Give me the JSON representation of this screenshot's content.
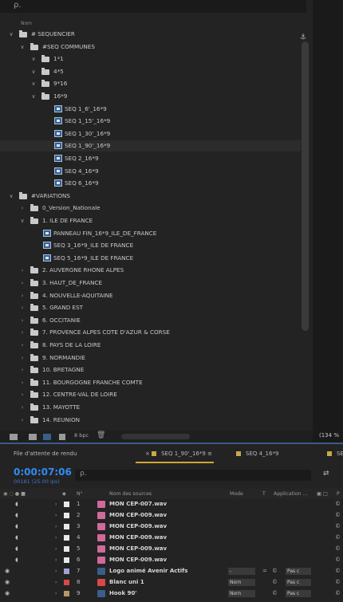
{
  "project": {
    "search_glyph": "ρ.",
    "column_header": "Nom",
    "tree": [
      {
        "label": "# SEQUENCIER",
        "type": "folder",
        "depth": 0,
        "expanded": true
      },
      {
        "label": "#SEQ COMMUNES",
        "type": "folder",
        "depth": 1,
        "expanded": true
      },
      {
        "label": "1*1",
        "type": "folder",
        "depth": 2,
        "expanded": true
      },
      {
        "label": "4*5",
        "type": "folder",
        "depth": 2,
        "expanded": true
      },
      {
        "label": "9*16",
        "type": "folder",
        "depth": 2,
        "expanded": true
      },
      {
        "label": "16*9",
        "type": "folder",
        "depth": 2,
        "expanded": true
      },
      {
        "label": "SEQ 1_6'_16*9",
        "type": "comp",
        "depth": 3
      },
      {
        "label": "SEQ 1_15'_16*9",
        "type": "comp",
        "depth": 3
      },
      {
        "label": "SEQ 1_30'_16*9",
        "type": "comp",
        "depth": 3
      },
      {
        "label": "SEQ 1_90'_16*9",
        "type": "comp",
        "depth": 3
      },
      {
        "label": "SEQ 2_16*9",
        "type": "comp",
        "depth": 3
      },
      {
        "label": "SEQ 4_16*9",
        "type": "comp",
        "depth": 3
      },
      {
        "label": "SEQ 6_16*9",
        "type": "comp",
        "depth": 3
      },
      {
        "label": "#VARIATIONS",
        "type": "folder",
        "depth": 0,
        "expanded": true
      },
      {
        "label": "0_Version_Nationale",
        "type": "folder",
        "depth": 1,
        "expanded": false
      },
      {
        "label": "1. ILE DE FRANCE",
        "type": "folder",
        "depth": 1,
        "expanded": true
      },
      {
        "label": "PANNEAU FIN_16*9_ILE_DE_FRANCE",
        "type": "comp",
        "depth": 2
      },
      {
        "label": "SEQ 3_16*9_ILE DE FRANCE",
        "type": "comp",
        "depth": 2
      },
      {
        "label": "SEQ 5_16*9_ILE DE FRANCE",
        "type": "comp",
        "depth": 2
      },
      {
        "label": "2. AUVERGNE RHONE ALPES",
        "type": "folder",
        "depth": 1,
        "expanded": false
      },
      {
        "label": "3. HAUT_DE_FRANCE",
        "type": "folder",
        "depth": 1,
        "expanded": false
      },
      {
        "label": "4. NOUVELLE-AQUITAINE",
        "type": "folder",
        "depth": 1,
        "expanded": false
      },
      {
        "label": "5. GRAND EST",
        "type": "folder",
        "depth": 1,
        "expanded": false
      },
      {
        "label": "6. OCCITANIE",
        "type": "folder",
        "depth": 1,
        "expanded": false
      },
      {
        "label": "7. PROVENCE ALPES COTE D'AZUR & CORSE",
        "type": "folder",
        "depth": 1,
        "expanded": false
      },
      {
        "label": "8. PAYS DE LA LOIRE",
        "type": "folder",
        "depth": 1,
        "expanded": false
      },
      {
        "label": "9. NORMANDIE",
        "type": "folder",
        "depth": 1,
        "expanded": false
      },
      {
        "label": "10. BRETAGNE",
        "type": "folder",
        "depth": 1,
        "expanded": false
      },
      {
        "label": "11. BOURGOGNE FRANCHE COMTE",
        "type": "folder",
        "depth": 1,
        "expanded": false
      },
      {
        "label": "12. CENTRE-VAL DE LOIRE",
        "type": "folder",
        "depth": 1,
        "expanded": false
      },
      {
        "label": "13. MAYOTTE",
        "type": "folder",
        "depth": 1,
        "expanded": false
      },
      {
        "label": "14. REUNION",
        "type": "folder",
        "depth": 1,
        "expanded": false
      }
    ],
    "bpc_label": "8 bpc"
  },
  "viewer": {
    "zoom_label": "(134 %"
  },
  "timeline": {
    "tabs": [
      {
        "label": "File d'attente de rendu",
        "active": false,
        "color": null
      },
      {
        "label": "SEQ 1_90'_16*9",
        "active": true,
        "color": "#c8a84a"
      },
      {
        "label": "SEQ 4_16*9",
        "active": false,
        "color": "#c8a84a"
      },
      {
        "label": "SE",
        "active": false,
        "color": "#c8a84a"
      }
    ],
    "timecode": "0:00:07:06",
    "frames": "00181 (25.00 ips)",
    "search_glyph": "ρ.",
    "headers": {
      "num": "N°",
      "source": "Nom des sources",
      "mode": "Mode",
      "t": "T",
      "application": "Application ...",
      "p": "P"
    },
    "layers": [
      {
        "num": "1",
        "name": "MON CEP-007.wav",
        "kind": "audio",
        "label_color": "#e8e8e8",
        "mode": "",
        "trk": ""
      },
      {
        "num": "2",
        "name": "MON CEP-009.wav",
        "kind": "audio",
        "label_color": "#e8e8e8",
        "mode": "",
        "trk": ""
      },
      {
        "num": "3",
        "name": "MON CEP-009.wav",
        "kind": "audio",
        "label_color": "#e8e8e8",
        "mode": "",
        "trk": ""
      },
      {
        "num": "4",
        "name": "MON CEP-009.wav",
        "kind": "audio",
        "label_color": "#e8e8e8",
        "mode": "",
        "trk": ""
      },
      {
        "num": "5",
        "name": "MON CEP-009.wav",
        "kind": "audio",
        "label_color": "#e8e8e8",
        "mode": "",
        "trk": ""
      },
      {
        "num": "6",
        "name": "MON CEP-009.wav",
        "kind": "audio",
        "label_color": "#e8e8e8",
        "mode": "",
        "trk": ""
      },
      {
        "num": "7",
        "name": "Logo animé Avenir Actifs",
        "kind": "comp",
        "label_color": "#a0a0d8",
        "mode": "-",
        "trk": "Pas c"
      },
      {
        "num": "8",
        "name": "Blanc uni 1",
        "kind": "solid",
        "label_color": "#d84848",
        "mode": "Norn",
        "trk": "Pas c"
      },
      {
        "num": "9",
        "name": "Hook 90'",
        "kind": "comp",
        "label_color": "#b89868",
        "mode": "Norn",
        "trk": "Pas c"
      }
    ]
  }
}
